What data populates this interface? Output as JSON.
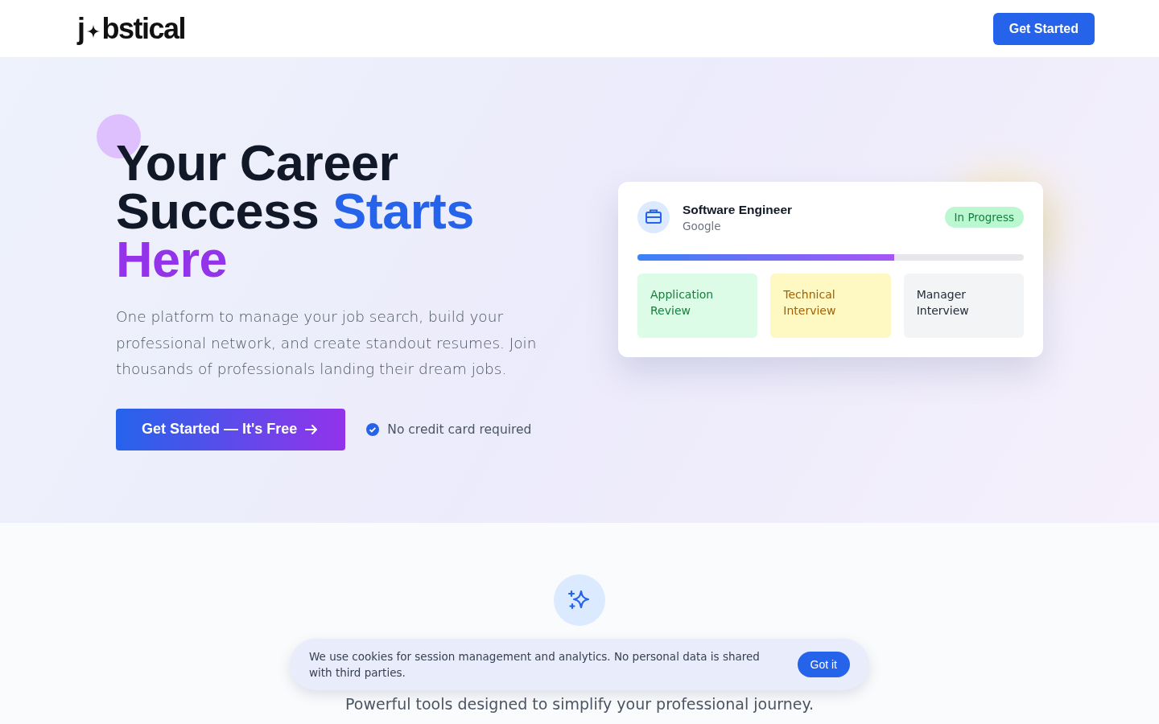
{
  "header": {
    "logo": {
      "before": "j",
      "after": "bstical"
    },
    "cta": "Get Started"
  },
  "hero": {
    "headline": [
      {
        "text": "Your Career Success ",
        "color": "#111827"
      },
      {
        "text": "Starts",
        "color": "#2563eb"
      },
      {
        "text": " Here",
        "color": "#9333ea"
      }
    ],
    "lead": "One platform to manage your job search, build your professional network, and create standout resumes. Join thousands of professionals landing their dream jobs.",
    "cta": "Get Started — It's Free",
    "note": "No credit card required"
  },
  "card": {
    "title": "Software Engineer",
    "company": "Google",
    "badge": "In Progress",
    "level": 0.665,
    "stages": [
      {
        "label": "Application Review",
        "color": "#dcfce7"
      },
      {
        "label": "Technical Interview",
        "color": "#fef9c3"
      },
      {
        "label": "Manager Interview",
        "color": "#f3f4f6"
      }
    ]
  },
  "features": {
    "subtitle": "Powerful tools designed to simplify your professional journey."
  },
  "cookie": {
    "text": "We use cookies for session management and analytics. No personal data is shared with third parties.",
    "button": "Got it"
  }
}
